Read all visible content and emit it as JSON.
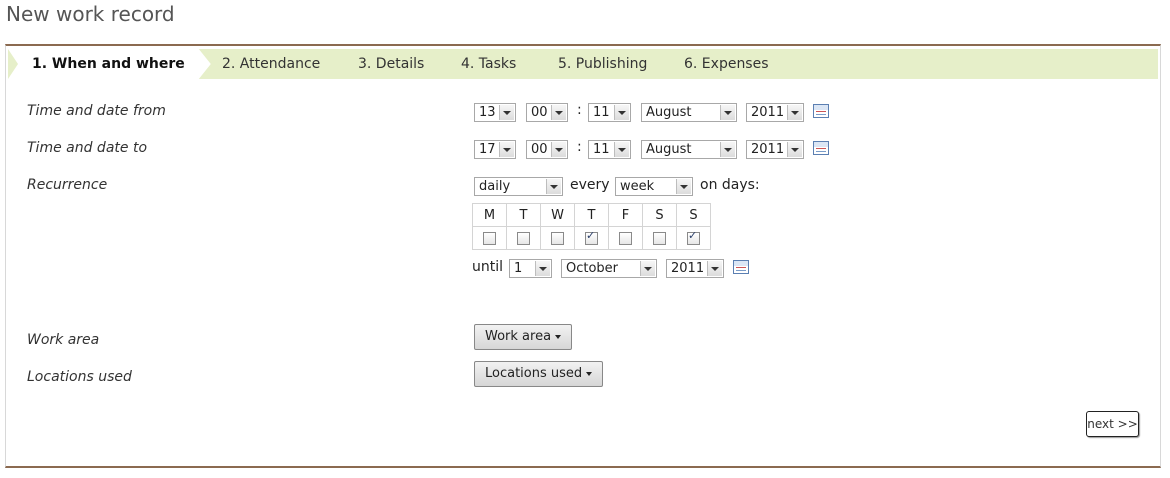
{
  "page_title": "New work record",
  "tabs": [
    {
      "label": "1. When and where",
      "active": true
    },
    {
      "label": "2. Attendance"
    },
    {
      "label": "3. Details"
    },
    {
      "label": "4. Tasks"
    },
    {
      "label": "5. Publishing"
    },
    {
      "label": "6. Expenses"
    }
  ],
  "from": {
    "label": "Time and date from",
    "hour": "13",
    "minute": "00",
    "day": "11",
    "month": "August",
    "year": "2011",
    "time_separator": ":"
  },
  "to": {
    "label": "Time and date to",
    "hour": "17",
    "minute": "00",
    "day": "11",
    "month": "August",
    "year": "2011",
    "time_separator": ":"
  },
  "recurrence": {
    "label": "Recurrence",
    "frequency": "daily",
    "every_text": "every",
    "period": "week",
    "on_days_text": "on days:",
    "days": [
      {
        "label": "M",
        "checked": false
      },
      {
        "label": "T",
        "checked": false
      },
      {
        "label": "W",
        "checked": false
      },
      {
        "label": "T",
        "checked": true
      },
      {
        "label": "F",
        "checked": false
      },
      {
        "label": "S",
        "checked": false
      },
      {
        "label": "S",
        "checked": true
      }
    ],
    "until_text": "until",
    "until_day": "1",
    "until_month": "October",
    "until_year": "2011"
  },
  "work_area": {
    "label": "Work area",
    "button": "Work area"
  },
  "locations": {
    "label": "Locations used",
    "button": "Locations used"
  },
  "next_button": "next >>",
  "icons": {
    "calendar": "calendar-icon",
    "dropdown": "chevron-down-icon"
  }
}
